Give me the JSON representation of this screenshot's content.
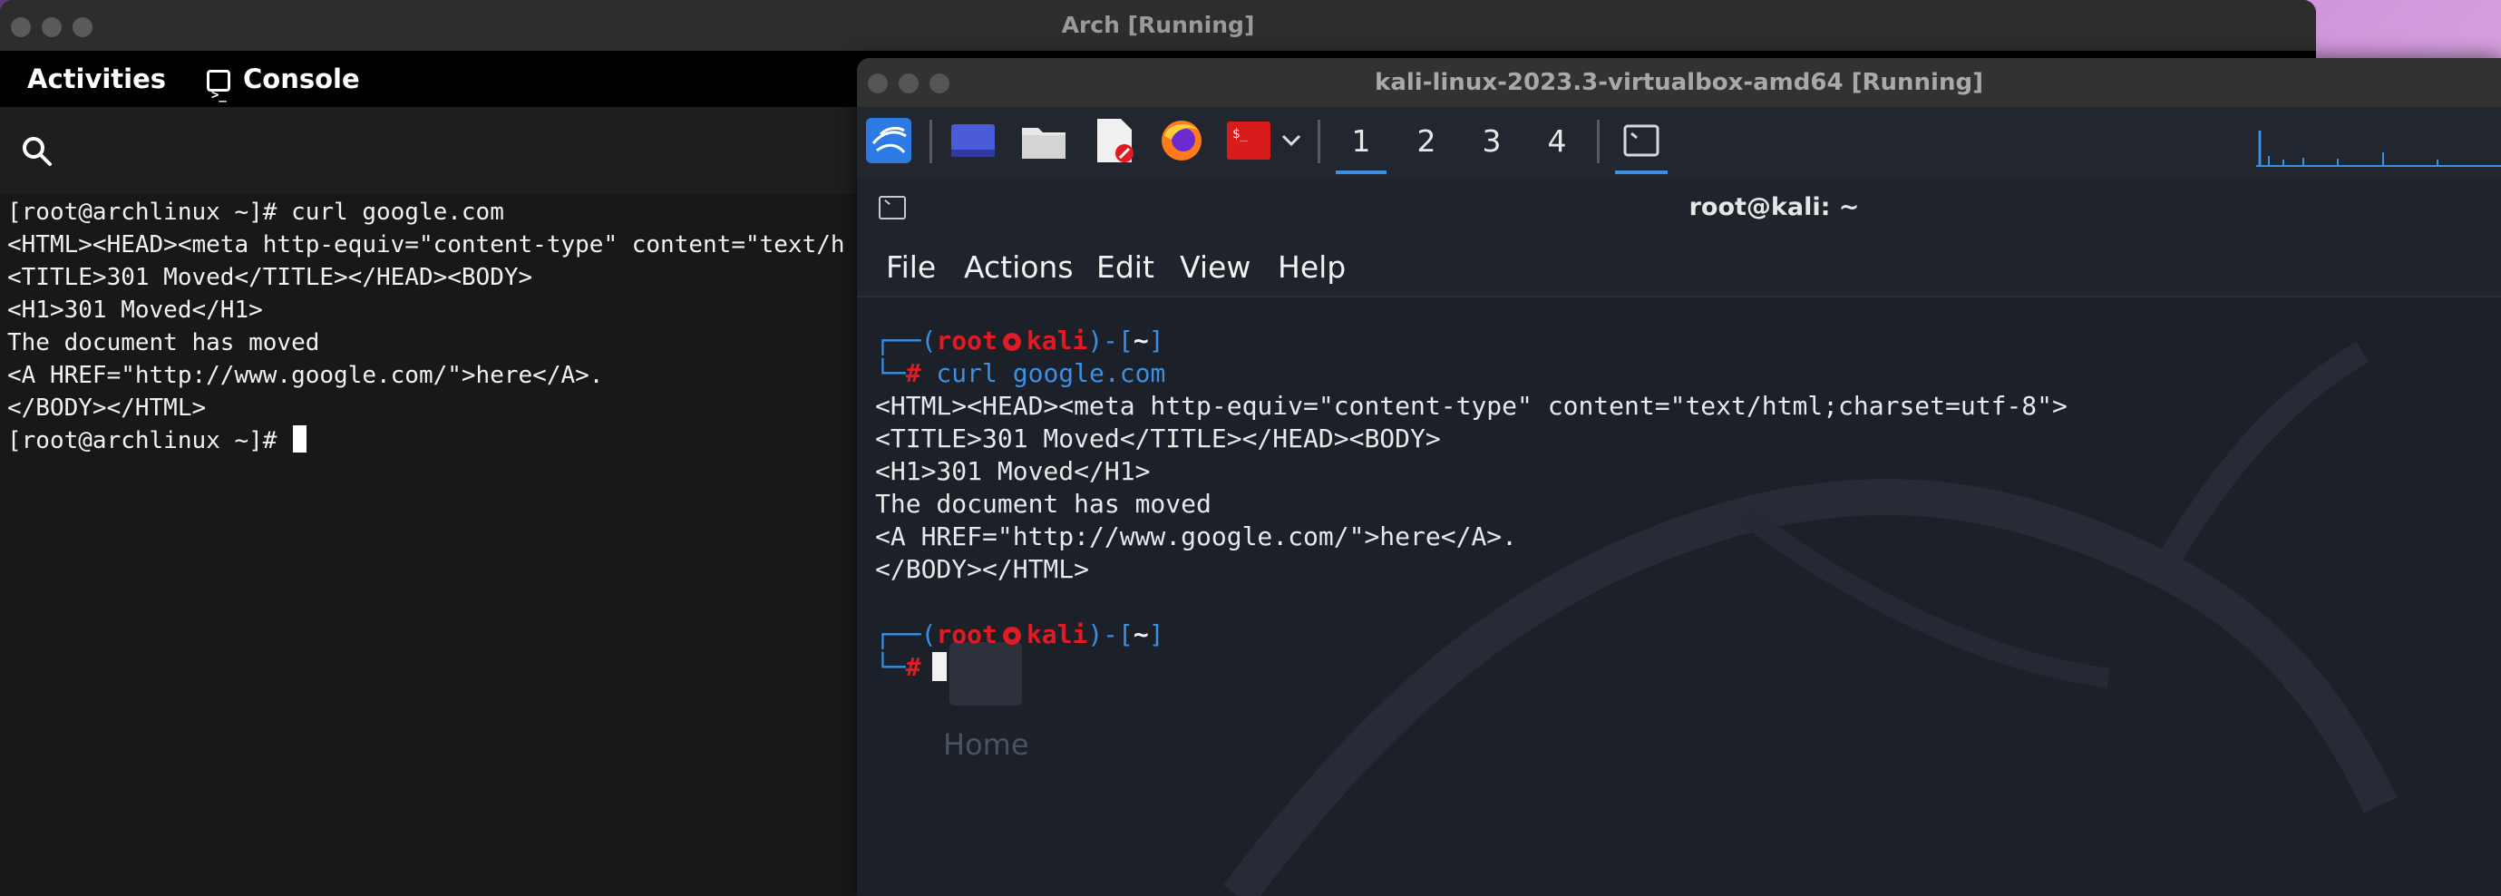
{
  "arch_window": {
    "title": "Arch [Running]",
    "activities": "Activities",
    "console_label": "Console",
    "terminal_lines": [
      "[root@archlinux ~]# curl google.com",
      "<HTML><HEAD><meta http-equiv=\"content-type\" content=\"text/h",
      "<TITLE>301 Moved</TITLE></HEAD><BODY>",
      "<H1>301 Moved</H1>",
      "The document has moved",
      "<A HREF=\"http://www.google.com/\">here</A>.",
      "</BODY></HTML>"
    ],
    "prompt": "[root@archlinux ~]# "
  },
  "kali_window": {
    "title": "kali-linux-2023.3-virtualbox-amd64 [Running]",
    "workspaces": [
      "1",
      "2",
      "3",
      "4"
    ],
    "terminal_title": "root@kali: ~",
    "menu": [
      "File",
      "Actions",
      "Edit",
      "View",
      "Help"
    ],
    "prompt_open": "┌──(",
    "prompt_user": "root",
    "prompt_host": "kali",
    "prompt_mid": ")-[",
    "prompt_cwd": "~",
    "prompt_close": "]",
    "prompt_hash_prefix": "└─",
    "prompt_hash": "#",
    "command": " curl google.com",
    "output_lines": [
      "<HTML><HEAD><meta http-equiv=\"content-type\" content=\"text/html;charset=utf-8\">",
      "<TITLE>301 Moved</TITLE></HEAD><BODY>",
      "<H1>301 Moved</H1>",
      "The document has moved",
      "<A HREF=\"http://www.google.com/\">here</A>.",
      "</BODY></HTML>"
    ],
    "desktop_icon_label": "Home"
  },
  "colors": {
    "kali_blue": "#3b8fe5",
    "kali_red": "#e01b24"
  }
}
